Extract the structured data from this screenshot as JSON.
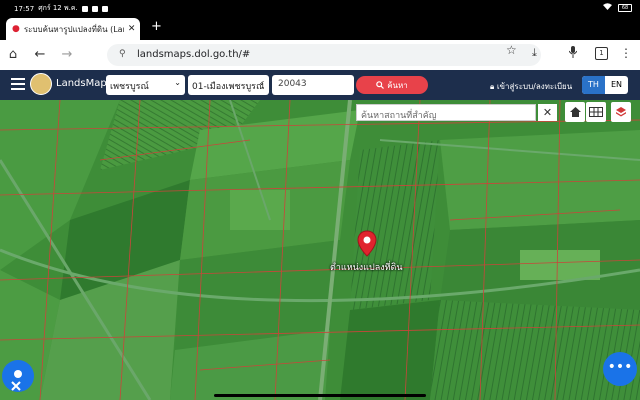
{
  "status_bar": {
    "time": "17:57",
    "date": "ศุกร์ 12 พ.ค.",
    "battery": "68"
  },
  "browser": {
    "tab_title": "ระบบค้นหารูปแปลงที่ดิน (LandsMaps)",
    "url": "landsmaps.dol.go.th/#",
    "tab_count": "1"
  },
  "app": {
    "logo_text": "LandsMaps",
    "province": "เพชรบูรณ์",
    "district": "01-เมืองเพชรบูรณ์",
    "parcel_number": "20043",
    "search_label": "ค้นหา",
    "login_label": "เข้าสู่ระบบ/ลงทะเบียน",
    "lang_th": "TH",
    "lang_en": "EN"
  },
  "map": {
    "place_search_placeholder": "ค้นหาสถานที่สำคัญ",
    "marker_label": "ตำแหน่งแปลงที่ดิน",
    "marker_color": "#e0242e",
    "parcel_line_color": "#c9463a"
  },
  "colors": {
    "header_bg": "#1d2e4c",
    "search_button": "#e8424a",
    "lang_active": "#2a72c8",
    "fab": "#1a73e8"
  }
}
